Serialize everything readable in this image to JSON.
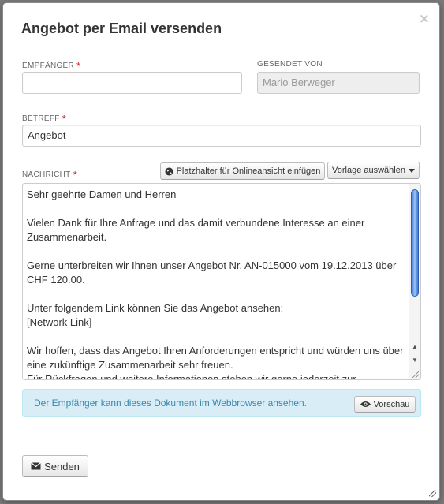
{
  "dialog": {
    "title": "Angebot per Email versenden",
    "close_glyph": "×"
  },
  "recipient": {
    "label": "EMPFÄNGER",
    "required_mark": "*",
    "value": ""
  },
  "sender": {
    "label": "GESENDET VON",
    "value": "Mario Berweger"
  },
  "subject": {
    "label": "BETREFF",
    "required_mark": "*",
    "value": "Angebot"
  },
  "message": {
    "label": "NACHRICHT",
    "required_mark": "*",
    "placeholder_button": "Platzhalter für Onlineansicht einfügen",
    "template_button": "Vorlage auswählen",
    "text": "Sehr geehrte Damen und Herren\n\nVielen Dank für Ihre Anfrage und das damit verbundene Interesse an einer Zusammenarbeit.\n\nGerne unterbreiten wir Ihnen unser Angebot Nr. AN-015000 vom 19.12.2013 über CHF 120.00.\n\nUnter folgendem Link können Sie das Angebot ansehen:\n[Network Link]\n\nWir hoffen, dass das Angebot Ihren Anforderungen entspricht und würden uns über eine zukünftige Zusammenarbeit sehr freuen.\nFür Rückfragen und weitere Informationen stehen wir gerne jederzeit zur"
  },
  "info": {
    "text": "Der Empfänger kann dieses Dokument im Webbrowser ansehen.",
    "preview_button": "Vorschau"
  },
  "footer": {
    "send_button": "Senden"
  },
  "icons": {
    "globe": "globe-icon",
    "caret": "caret-down-icon",
    "eye": "eye-icon",
    "envelope": "envelope-icon"
  },
  "colors": {
    "required": "#c02020",
    "info_bg": "#d9edf7",
    "info_text": "#3a87ad",
    "scroll_thumb": "#3b78d8"
  }
}
